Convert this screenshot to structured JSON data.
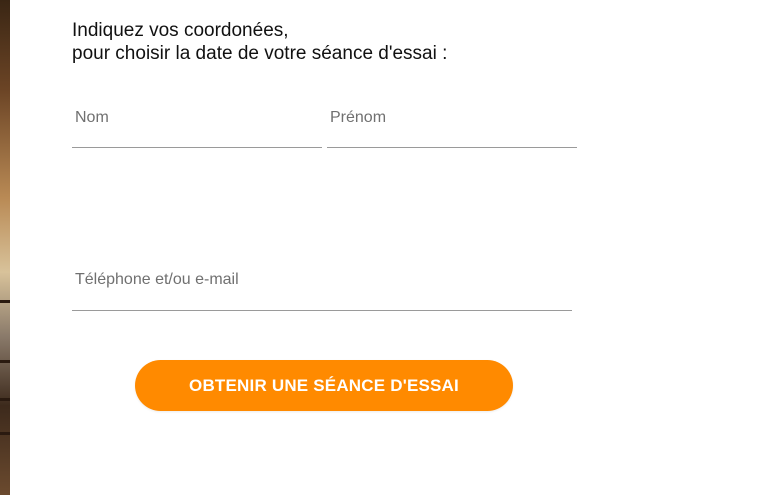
{
  "form": {
    "heading_line1": "Indiquez vos coordonées,",
    "heading_line2": "pour choisir la date de votre séance d'essai :",
    "fields": {
      "last_name": {
        "placeholder": "Nom",
        "value": ""
      },
      "first_name": {
        "placeholder": "Prénom",
        "value": ""
      },
      "contact": {
        "placeholder": "Téléphone et/ou e-mail",
        "value": ""
      }
    },
    "submit_label": "OBTENIR UNE SÉANCE D'ESSAI"
  },
  "colors": {
    "accent": "#ff8a00",
    "text": "#111111",
    "placeholder": "#707070",
    "underline": "#9a9a9a"
  }
}
